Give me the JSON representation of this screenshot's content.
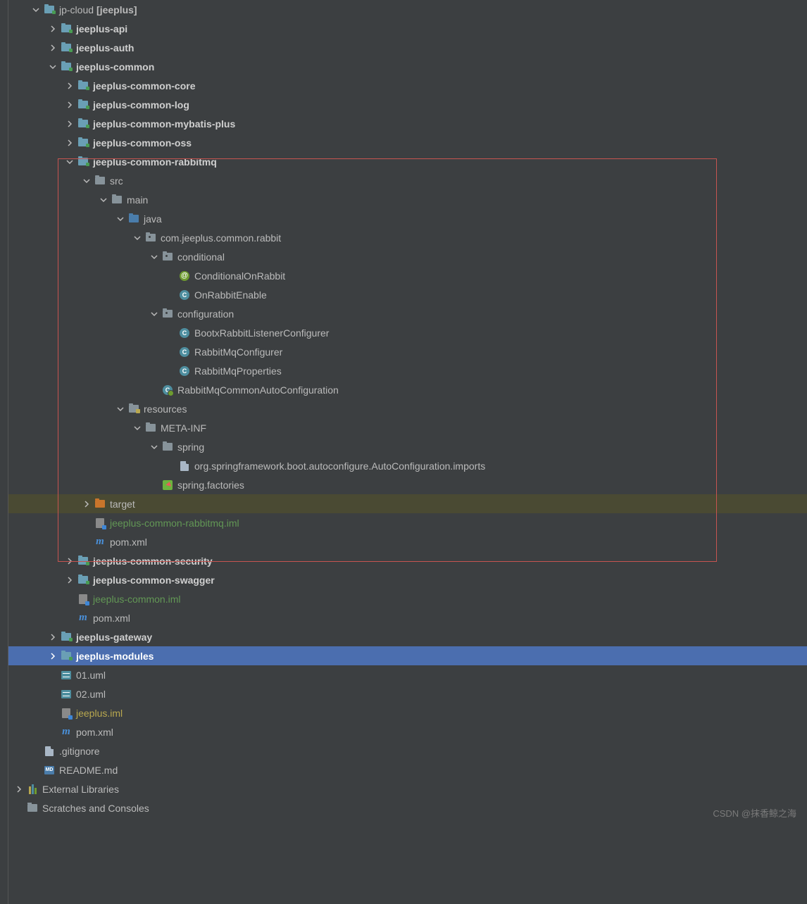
{
  "tree": {
    "root": {
      "label": "jp-cloud",
      "bracket": "[jeeplus]"
    },
    "modules": {
      "api": "jeeplus-api",
      "auth": "jeeplus-auth",
      "common": "jeeplus-common",
      "common_core": "jeeplus-common-core",
      "common_log": "jeeplus-common-log",
      "common_mybatis": "jeeplus-common-mybatis-plus",
      "common_oss": "jeeplus-common-oss",
      "common_rabbit": "jeeplus-common-rabbitmq",
      "common_security": "jeeplus-common-security",
      "common_swagger": "jeeplus-common-swagger",
      "gateway": "jeeplus-gateway",
      "modules": "jeeplus-modules"
    },
    "src": "src",
    "main": "main",
    "java": "java",
    "pkg_rabbit": "com.jeeplus.common.rabbit",
    "pkg_conditional": "conditional",
    "pkg_configuration": "configuration",
    "classes": {
      "cond_on_rabbit": "ConditionalOnRabbit",
      "on_rabbit_enable": "OnRabbitEnable",
      "bootx_listener": "BootxRabbitListenerConfigurer",
      "rabbit_configurer": "RabbitMqConfigurer",
      "rabbit_props": "RabbitMqProperties",
      "rabbit_auto": "RabbitMqCommonAutoConfiguration"
    },
    "resources": "resources",
    "metainf": "META-INF",
    "spring": "spring",
    "files": {
      "autoconf_imports": "org.springframework.boot.autoconfigure.AutoConfiguration.imports",
      "spring_factories": "spring.factories",
      "target": "target",
      "rabbit_iml": "jeeplus-common-rabbitmq.iml",
      "pom": "pom.xml",
      "common_iml": "jeeplus-common.iml",
      "uml1": "01.uml",
      "uml2": "02.uml",
      "jeeplus_iml": "jeeplus.iml",
      "gitignore": ".gitignore",
      "readme": "README.md"
    },
    "external_libs": "External Libraries",
    "scratches": "Scratches and Consoles"
  },
  "watermark": "CSDN @抹香鲸之海"
}
